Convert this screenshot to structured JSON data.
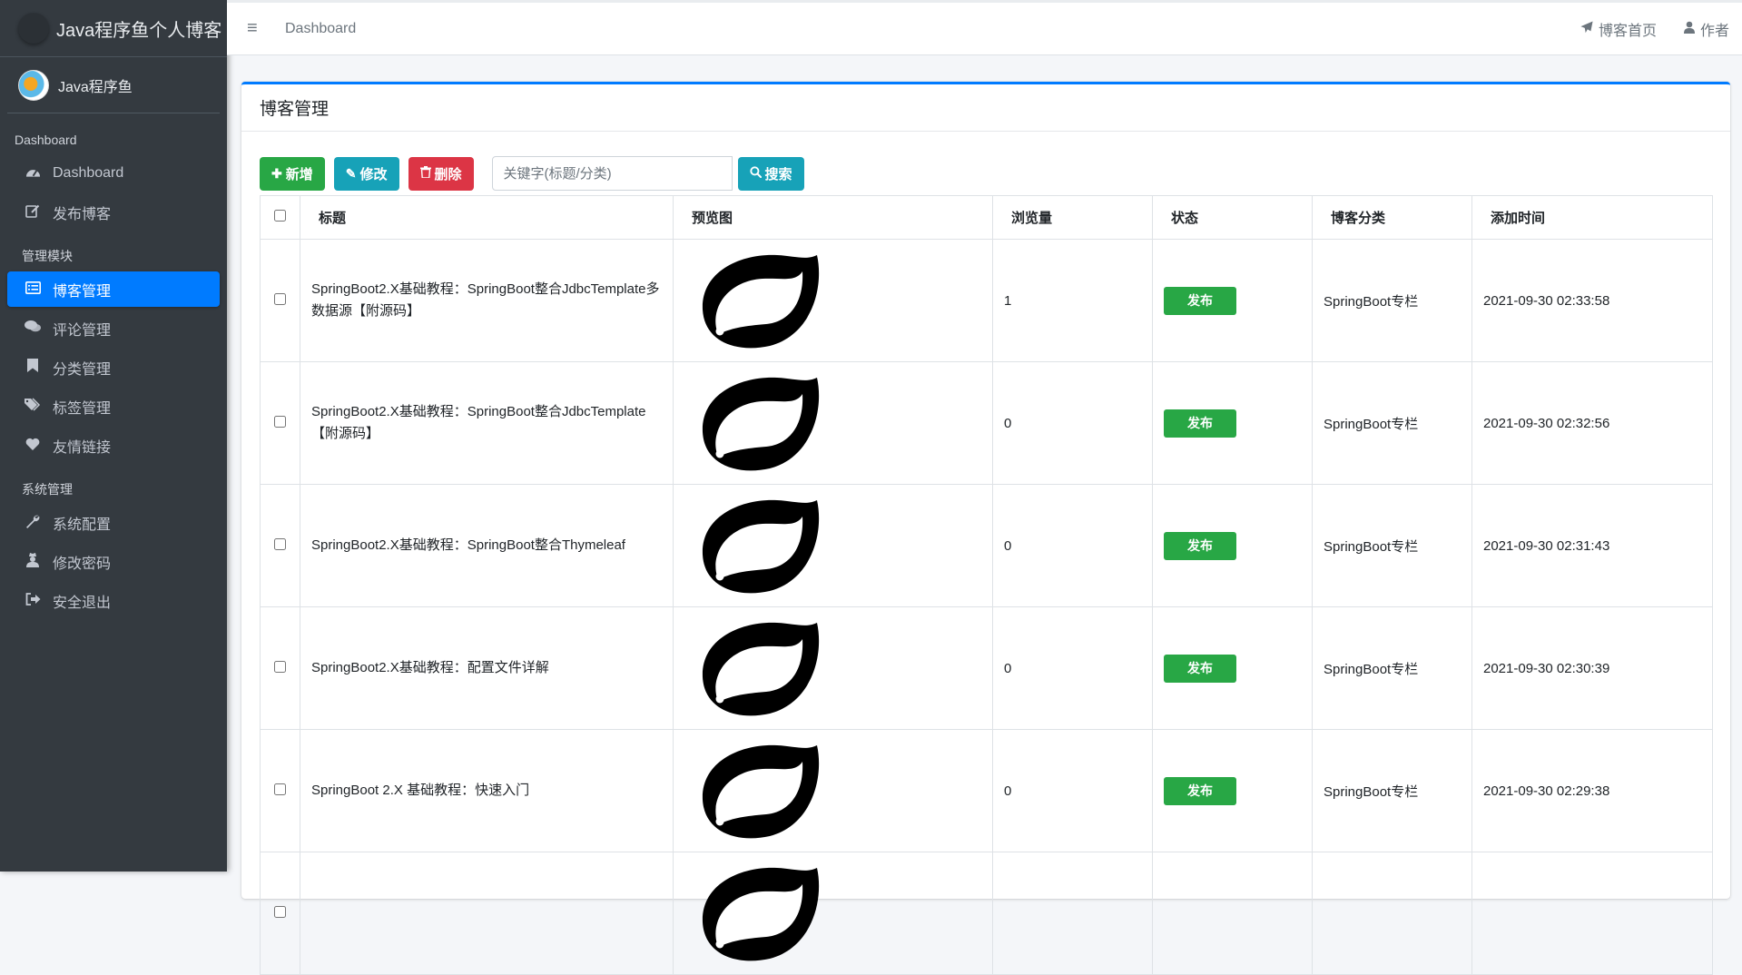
{
  "brand": {
    "title": "Java程序鱼个人博客"
  },
  "user": {
    "name": "Java程序鱼"
  },
  "sidebar": {
    "sections": [
      {
        "header": "Dashboard",
        "items": [
          {
            "label": "Dashboard",
            "icon": "tachometer-icon"
          },
          {
            "label": "发布博客",
            "icon": "edit-icon"
          }
        ]
      },
      {
        "header": "管理模块",
        "items": [
          {
            "label": "博客管理",
            "icon": "list-alt-icon",
            "active": true
          },
          {
            "label": "评论管理",
            "icon": "comments-icon"
          },
          {
            "label": "分类管理",
            "icon": "bookmark-icon"
          },
          {
            "label": "标签管理",
            "icon": "tags-icon"
          },
          {
            "label": "友情链接",
            "icon": "heart-icon"
          }
        ]
      },
      {
        "header": "系统管理",
        "items": [
          {
            "label": "系统配置",
            "icon": "wrench-icon"
          },
          {
            "label": "修改密码",
            "icon": "user-secret-icon"
          },
          {
            "label": "安全退出",
            "icon": "sign-out-icon"
          }
        ]
      }
    ]
  },
  "topbar": {
    "breadcrumb": "Dashboard",
    "right_links": [
      {
        "label": "博客首页",
        "icon": "paper-plane-icon"
      },
      {
        "label": "作者",
        "icon": "user-icon"
      }
    ]
  },
  "card": {
    "title": "博客管理",
    "toolbar": {
      "add_label": "新增",
      "edit_label": "修改",
      "delete_label": "删除",
      "search_placeholder": "关键字(标题/分类)",
      "search_value": "",
      "search_label": "搜索"
    },
    "table": {
      "columns": [
        "标题",
        "预览图",
        "浏览量",
        "状态",
        "博客分类",
        "添加时间"
      ],
      "rows": [
        {
          "title": "SpringBoot2.X基础教程：SpringBoot整合JdbcTemplate多数据源【附源码】",
          "views": "1",
          "status": "发布",
          "category": "SpringBoot专栏",
          "time": "2021-09-30 02:33:58"
        },
        {
          "title": "SpringBoot2.X基础教程：SpringBoot整合JdbcTemplate【附源码】",
          "views": "0",
          "status": "发布",
          "category": "SpringBoot专栏",
          "time": "2021-09-30 02:32:56"
        },
        {
          "title": "SpringBoot2.X基础教程：SpringBoot整合Thymeleaf",
          "views": "0",
          "status": "发布",
          "category": "SpringBoot专栏",
          "time": "2021-09-30 02:31:43"
        },
        {
          "title": "SpringBoot2.X基础教程：配置文件详解",
          "views": "0",
          "status": "发布",
          "category": "SpringBoot专栏",
          "time": "2021-09-30 02:30:39"
        },
        {
          "title": "SpringBoot 2.X 基础教程：快速入门",
          "views": "0",
          "status": "发布",
          "category": "SpringBoot专栏",
          "time": "2021-09-30 02:29:38"
        },
        {
          "title": "",
          "views": "",
          "status": "",
          "category": "",
          "time": ""
        }
      ]
    }
  },
  "colors": {
    "sidebar_bg": "#343a40",
    "accent": "#007bff",
    "success": "#28a745",
    "info": "#17a2b8",
    "danger": "#dc3545"
  }
}
